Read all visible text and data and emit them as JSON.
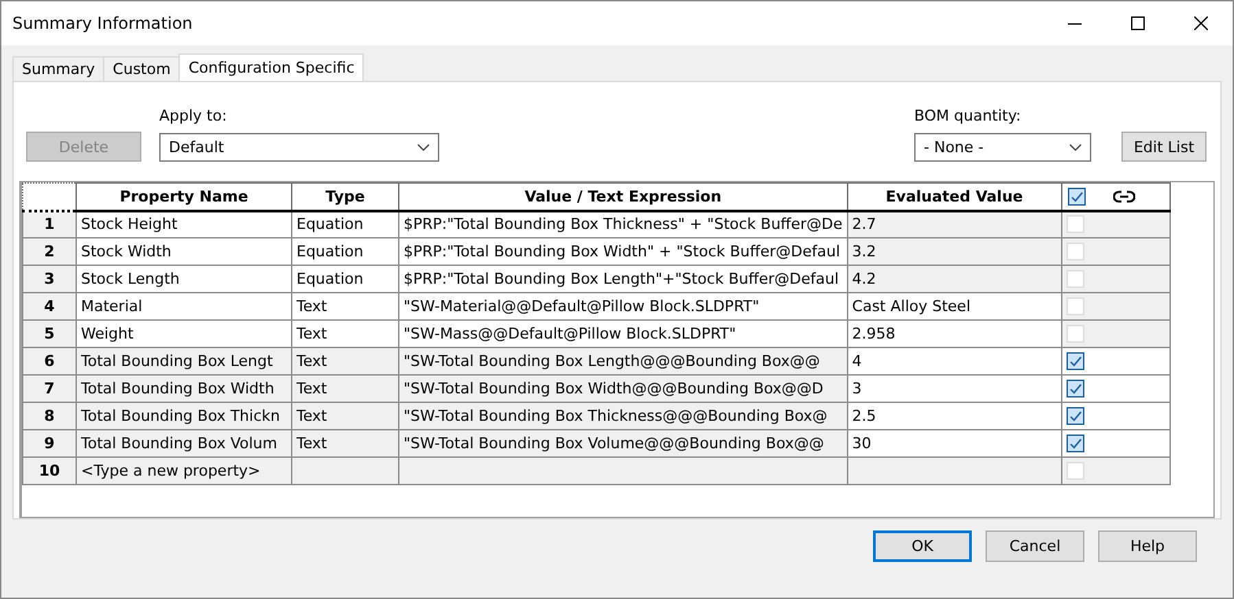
{
  "window": {
    "title": "Summary Information"
  },
  "tabs": [
    {
      "label": "Summary",
      "selected": false
    },
    {
      "label": "Custom",
      "selected": false
    },
    {
      "label": "Configuration Specific",
      "selected": true
    }
  ],
  "delete_button": {
    "label": "Delete",
    "disabled": true
  },
  "apply_to": {
    "label": "Apply to:",
    "value": "Default"
  },
  "bom_quantity": {
    "label": "BOM quantity:",
    "value": "- None -"
  },
  "edit_list_button": {
    "label": "Edit List"
  },
  "table": {
    "columns": [
      "Property Name",
      "Type",
      "Value / Text Expression",
      "Evaluated Value"
    ],
    "header_checked": true,
    "rows": [
      {
        "number": "1",
        "name": "Stock Height",
        "type": "Equation",
        "value": "$PRP:\"Total Bounding Box Thickness\" + \"Stock Buffer@De",
        "evaluated": "2.7",
        "kind": "equation",
        "checked": false,
        "disabled": true
      },
      {
        "number": "2",
        "name": "Stock Width",
        "type": "Equation",
        "value": "$PRP:\"Total Bounding Box Width\" + \"Stock Buffer@Defaul",
        "evaluated": "3.2",
        "kind": "equation",
        "checked": false,
        "disabled": true
      },
      {
        "number": "3",
        "name": "Stock Length",
        "type": "Equation",
        "value": "$PRP:\"Total Bounding Box Length\"+\"Stock Buffer@Defaul",
        "evaluated": "4.2",
        "kind": "equation",
        "checked": false,
        "disabled": true
      },
      {
        "number": "4",
        "name": "Material",
        "type": "Text",
        "value": "\"SW-Material@@Default@Pillow Block.SLDPRT\"",
        "evaluated": "Cast Alloy Steel",
        "kind": "text",
        "checked": false,
        "disabled": true
      },
      {
        "number": "5",
        "name": "Weight",
        "type": "Text",
        "value": "\"SW-Mass@@Default@Pillow Block.SLDPRT\"",
        "evaluated": "2.958",
        "kind": "text",
        "checked": false,
        "disabled": true
      },
      {
        "number": "6",
        "name": "Total Bounding Box Lengt",
        "type": "Text",
        "value": "\"SW-Total Bounding Box Length@@@Bounding Box@@",
        "evaluated": "4",
        "kind": "linked",
        "checked": true,
        "disabled": false
      },
      {
        "number": "7",
        "name": "Total Bounding Box Width",
        "type": "Text",
        "value": "\"SW-Total Bounding Box Width@@@Bounding Box@@D",
        "evaluated": "3",
        "kind": "linked",
        "checked": true,
        "disabled": false
      },
      {
        "number": "8",
        "name": "Total Bounding Box Thickn",
        "type": "Text",
        "value": "\"SW-Total Bounding Box Thickness@@@Bounding Box@",
        "evaluated": "2.5",
        "kind": "linked",
        "checked": true,
        "disabled": false
      },
      {
        "number": "9",
        "name": "Total Bounding Box Volum",
        "type": "Text",
        "value": "\"SW-Total Bounding Box Volume@@@Bounding Box@@",
        "evaluated": "30",
        "kind": "linked",
        "checked": true,
        "disabled": false
      },
      {
        "number": "10",
        "name": "<Type a new property>",
        "kind": "new",
        "checked": false,
        "disabled": true
      }
    ]
  },
  "buttons": [
    {
      "label": "OK",
      "default": true
    },
    {
      "label": "Cancel",
      "default": false
    },
    {
      "label": "Help",
      "default": false
    }
  ]
}
